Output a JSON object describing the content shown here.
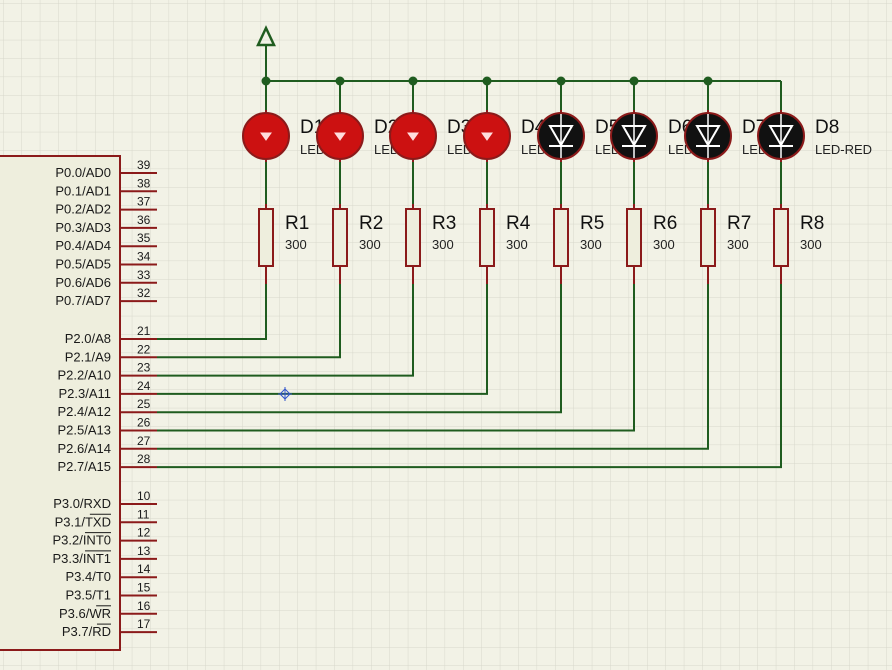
{
  "colors": {
    "background": "#f2f2e6",
    "grid": "#d8d8cc",
    "wire": "#1f5c1f",
    "component": "#8b1a1a",
    "body_fill": "#eeeedd",
    "led_on": "#cc1111",
    "led_off": "#111111"
  },
  "mcu": {
    "port0_pins": [
      {
        "name": "P0.0/AD0",
        "num": "39"
      },
      {
        "name": "P0.1/AD1",
        "num": "38"
      },
      {
        "name": "P0.2/AD2",
        "num": "37"
      },
      {
        "name": "P0.3/AD3",
        "num": "36"
      },
      {
        "name": "P0.4/AD4",
        "num": "35"
      },
      {
        "name": "P0.5/AD5",
        "num": "34"
      },
      {
        "name": "P0.6/AD6",
        "num": "33"
      },
      {
        "name": "P0.7/AD7",
        "num": "32"
      }
    ],
    "port2_pins": [
      {
        "name": "P2.0/A8",
        "num": "21"
      },
      {
        "name": "P2.1/A9",
        "num": "22"
      },
      {
        "name": "P2.2/A10",
        "num": "23"
      },
      {
        "name": "P2.3/A11",
        "num": "24"
      },
      {
        "name": "P2.4/A12",
        "num": "25"
      },
      {
        "name": "P2.5/A13",
        "num": "26"
      },
      {
        "name": "P2.6/A14",
        "num": "27"
      },
      {
        "name": "P2.7/A15",
        "num": "28"
      }
    ],
    "port3_pins": [
      {
        "name": "P3.0/RXD",
        "num": "10"
      },
      {
        "name": "P3.1/TXD",
        "num": "11"
      },
      {
        "name": "P3.2/INT0",
        "num": "12"
      },
      {
        "name": "P3.3/INT1",
        "num": "13"
      },
      {
        "name": "P3.4/T0",
        "num": "14"
      },
      {
        "name": "P3.5/T1",
        "num": "15"
      },
      {
        "name": "P3.6/WR",
        "num": "16"
      },
      {
        "name": "P3.7/RD",
        "num": "17"
      }
    ]
  },
  "leds": [
    {
      "ref": "D1",
      "value": "LED-RED",
      "on": true
    },
    {
      "ref": "D2",
      "value": "LED-RED",
      "on": true
    },
    {
      "ref": "D3",
      "value": "LED-RED",
      "on": true
    },
    {
      "ref": "D4",
      "value": "LED-RED",
      "on": true
    },
    {
      "ref": "D5",
      "value": "LED-RED",
      "on": false
    },
    {
      "ref": "D6",
      "value": "LED-RED",
      "on": false
    },
    {
      "ref": "D7",
      "value": "LED-RED",
      "on": false
    },
    {
      "ref": "D8",
      "value": "LED-RED",
      "on": false
    }
  ],
  "resistors": [
    {
      "ref": "R1",
      "value": "300"
    },
    {
      "ref": "R2",
      "value": "300"
    },
    {
      "ref": "R3",
      "value": "300"
    },
    {
      "ref": "R4",
      "value": "300"
    },
    {
      "ref": "R5",
      "value": "300"
    },
    {
      "ref": "R6",
      "value": "300"
    },
    {
      "ref": "R7",
      "value": "300"
    },
    {
      "ref": "R8",
      "value": "300"
    }
  ]
}
